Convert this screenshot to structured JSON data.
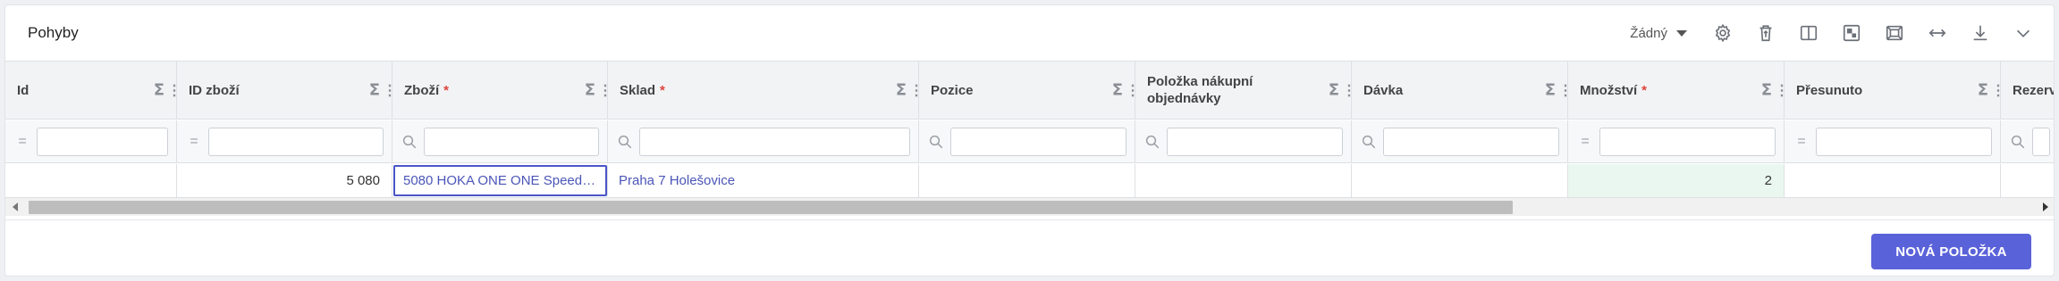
{
  "panel": {
    "title": "Pohyby"
  },
  "toolbar": {
    "view_select": "Žádný",
    "icons": [
      "gear-icon",
      "trash-icon",
      "columns-icon",
      "layout-icon",
      "fullscreen-icon",
      "fit-width-icon",
      "download-icon",
      "chevron-down-icon"
    ]
  },
  "table": {
    "columns": [
      {
        "label": "Id",
        "required": false,
        "filter": "equals"
      },
      {
        "label": "ID zboží",
        "required": false,
        "filter": "equals"
      },
      {
        "label": "Zboží",
        "required": true,
        "filter": "search"
      },
      {
        "label": "Sklad",
        "required": true,
        "filter": "search"
      },
      {
        "label": "Pozice",
        "required": false,
        "filter": "search"
      },
      {
        "label": "Položka nákupní objednávky",
        "required": false,
        "filter": "search"
      },
      {
        "label": "Dávka",
        "required": false,
        "filter": "search"
      },
      {
        "label": "Množství",
        "required": true,
        "filter": "equals"
      },
      {
        "label": "Přesunuto",
        "required": false,
        "filter": "equals"
      },
      {
        "label": "Rezerv",
        "required": false,
        "filter": "search"
      }
    ],
    "rows": [
      {
        "id": "",
        "goods_id": "5 080",
        "goods": "5080 HOKA ONE ONE Speed…",
        "warehouse": "Praha 7 Holešovice",
        "position": "",
        "po_item": "",
        "batch": "",
        "quantity": "2",
        "moved": "",
        "reserved": ""
      }
    ],
    "required_mark": "*",
    "sigma": "Σ",
    "equals_op": "="
  },
  "footer": {
    "new_item_label": "NOVÁ POLOŽKA"
  },
  "colors": {
    "accent": "#5a62d9",
    "link": "#4a55b8",
    "required": "#e0443a",
    "qty_bg": "#eaf7f0"
  }
}
